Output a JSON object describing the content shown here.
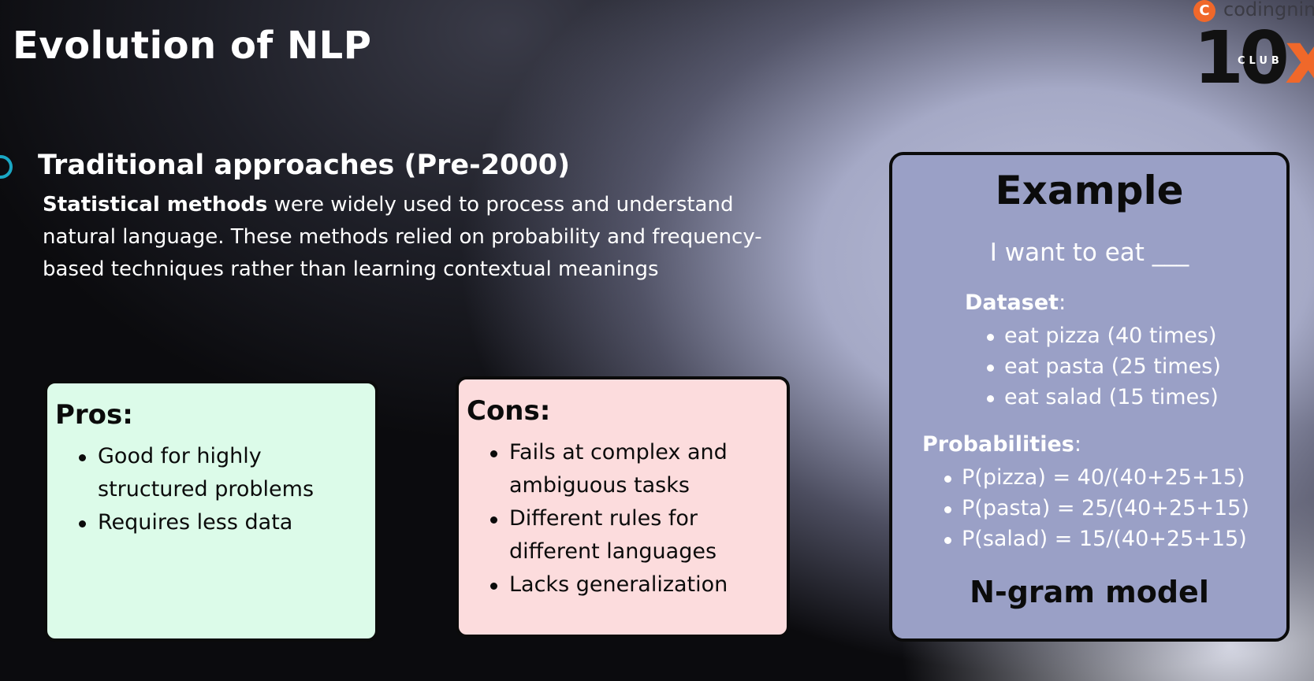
{
  "slide": {
    "title": "Evolution of NLP"
  },
  "section": {
    "heading": "Traditional approaches (Pre-2000)",
    "body_bold": "Statistical methods",
    "body_rest": " were widely used to process and understand natural language. These methods relied on probability and frequency-based techniques rather than learning contextual meanings"
  },
  "pros": {
    "title": "Pros:",
    "items": [
      "Good for highly structured problems",
      "Requires less data"
    ]
  },
  "cons": {
    "title": "Cons:",
    "items": [
      "Fails at complex and ambiguous tasks",
      "Different rules for different languages",
      "Lacks generalization"
    ]
  },
  "example": {
    "title": "Example",
    "prompt": "I want to eat ___",
    "dataset_label": "Dataset",
    "dataset": [
      "eat pizza (40 times)",
      "eat pasta (25 times)",
      "eat salad (15 times)"
    ],
    "probabilities_label": "Probabilities",
    "probabilities": [
      "P(pizza) = 40/(40+25+15)",
      "P(pasta) = 25/(40+25+15)",
      "P(salad) = 15/(40+25+15)"
    ],
    "footer": "N-gram model"
  },
  "brand": {
    "name": "codingnin",
    "number": "10",
    "x": "x",
    "club": "CLUB"
  },
  "colors": {
    "pros_bg": "#dcfbe9",
    "cons_bg": "#fcdcdd",
    "example_bg": "#9aa0c6",
    "accent": "#1aa7c4",
    "brand": "#f0682a"
  }
}
